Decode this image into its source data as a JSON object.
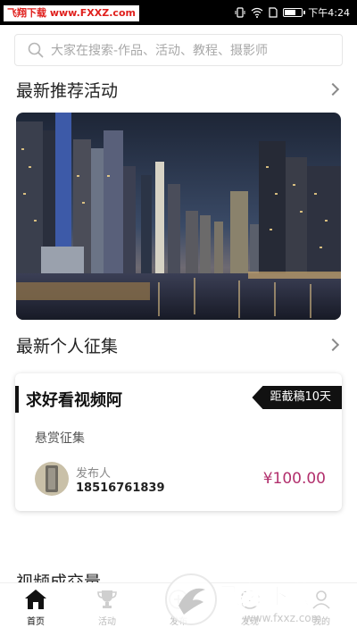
{
  "status_bar": {
    "watermark": "飞翔下载 www.FXXZ.com",
    "time": "下午4:24"
  },
  "search": {
    "placeholder": "大家在搜索-作品、活动、教程、摄影师"
  },
  "sections": {
    "activities_title": "最新推荐活动",
    "collections_title": "最新个人征集",
    "video_title": "视频成交量"
  },
  "card": {
    "title": "求好看视频阿",
    "deadline": "距截稿10天",
    "subtitle": "悬赏征集",
    "publisher_label": "发布人",
    "publisher_phone": "18516761839",
    "price": "¥100.00"
  },
  "nav": {
    "items": [
      {
        "label": "首页",
        "icon": "home-icon",
        "active": true
      },
      {
        "label": "活动",
        "icon": "trophy-icon",
        "active": false
      },
      {
        "label": "发布",
        "icon": "plus-icon",
        "active": false
      },
      {
        "label": "发现",
        "icon": "compass-icon",
        "active": false
      },
      {
        "label": "我的",
        "icon": "user-icon",
        "active": false
      }
    ]
  },
  "watermark_bottom": {
    "brand": "飞翔下载",
    "url": "www.fxxz.com"
  },
  "colors": {
    "price": "#b2306d",
    "watermark_red": "#e0201d",
    "accent_dark": "#111111"
  }
}
